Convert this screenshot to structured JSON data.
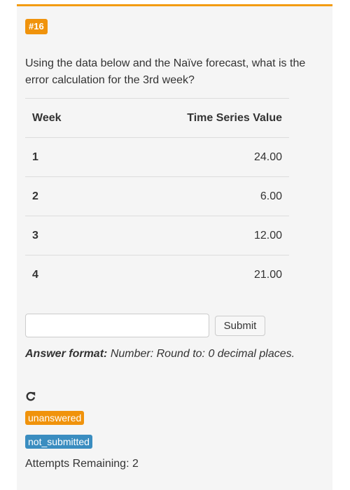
{
  "question": {
    "number": "#16",
    "text": "Using the data below and the Naïve forecast, what is the error calculation for the 3rd week?"
  },
  "table": {
    "headers": [
      "Week",
      "Time Series Value"
    ],
    "rows": [
      [
        "1",
        "24.00"
      ],
      [
        "2",
        "6.00"
      ],
      [
        "3",
        "12.00"
      ],
      [
        "4",
        "21.00"
      ]
    ]
  },
  "answer": {
    "value": "",
    "placeholder": "",
    "submit_label": "Submit",
    "format_label": "Answer format:",
    "format_text": "Number: Round to: 0 decimal places."
  },
  "status": {
    "retry_icon": "retry-icon",
    "answer_state": "unanswered",
    "submit_state": "not_submitted",
    "attempts_text": "Attempts Remaining: 2"
  },
  "colors": {
    "accent_orange": "#f0930c",
    "badge_blue": "#3a8dc0"
  }
}
